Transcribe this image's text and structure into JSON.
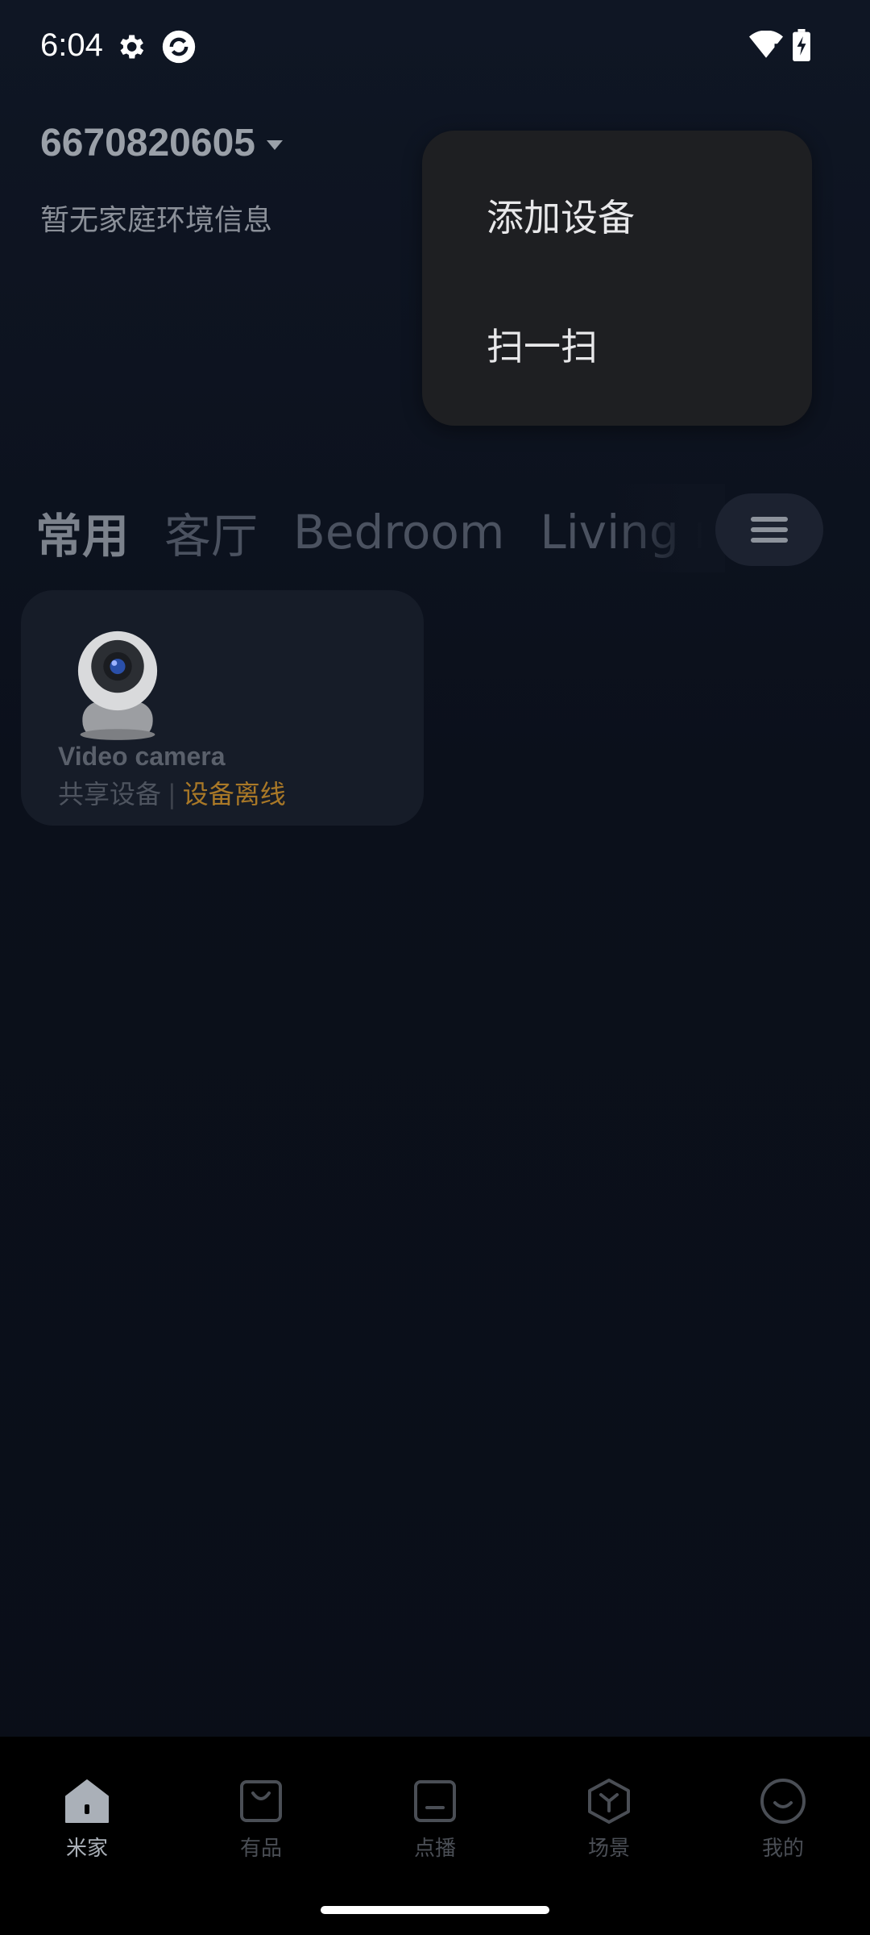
{
  "status_bar": {
    "time": "6:04"
  },
  "home": {
    "id": "6670820605",
    "subtitle": "暂无家庭环境信息"
  },
  "popup_menu": {
    "items": [
      "添加设备",
      "扫一扫"
    ]
  },
  "room_tabs": [
    "常用",
    "客厅",
    "Bedroom",
    "Living roo"
  ],
  "active_tab": "常用",
  "device": {
    "name": "Video camera",
    "share_label": "共享设备",
    "separator": "|",
    "status": "设备离线"
  },
  "bottom_nav": {
    "items": [
      {
        "label": "米家",
        "icon": "home-icon",
        "active": true
      },
      {
        "label": "有品",
        "icon": "bag-icon",
        "active": false
      },
      {
        "label": "点播",
        "icon": "play-icon",
        "active": false
      },
      {
        "label": "场景",
        "icon": "cube-icon",
        "active": false
      },
      {
        "label": "我的",
        "icon": "smile-icon",
        "active": false
      }
    ]
  },
  "colors": {
    "offline": "#a97827",
    "popup_bg": "#1e1f22",
    "page_bg": "#0b101b"
  }
}
